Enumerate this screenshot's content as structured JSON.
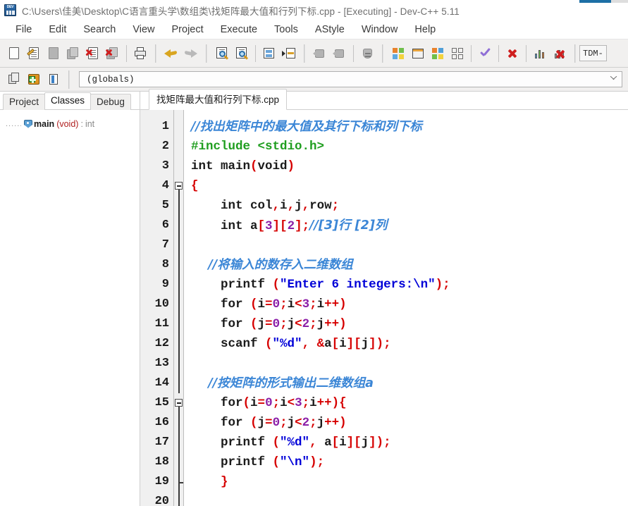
{
  "titlebar": {
    "title": "C:\\Users\\佳美\\Desktop\\C语言重头学\\数组类\\找矩阵最大值和行列下标.cpp - [Executing] - Dev-C++ 5.11",
    "icon": "devcpp-app-icon"
  },
  "menubar": {
    "items": [
      {
        "label": "File"
      },
      {
        "label": "Edit"
      },
      {
        "label": "Search"
      },
      {
        "label": "View"
      },
      {
        "label": "Project"
      },
      {
        "label": "Execute"
      },
      {
        "label": "Tools"
      },
      {
        "label": "AStyle"
      },
      {
        "label": "Window"
      },
      {
        "label": "Help"
      }
    ]
  },
  "toolbar": {
    "compiler_select": "TDM-",
    "buttons": [
      {
        "name": "new-file-icon"
      },
      {
        "name": "open-file-icon"
      },
      {
        "name": "save-file-icon"
      },
      {
        "name": "save-all-icon"
      },
      {
        "name": "close-file-icon"
      },
      {
        "name": "close-all-icon"
      },
      {
        "name": "print-icon"
      },
      {
        "name": "undo-icon"
      },
      {
        "name": "redo-icon"
      },
      {
        "name": "find-icon"
      },
      {
        "name": "replace-icon"
      },
      {
        "name": "goto-line-icon"
      },
      {
        "name": "goto-function-icon"
      },
      {
        "name": "back-icon"
      },
      {
        "name": "forward-icon"
      },
      {
        "name": "toggle-breakpoint-icon"
      },
      {
        "name": "compile-icon"
      },
      {
        "name": "run-icon"
      },
      {
        "name": "compile-and-run-icon"
      },
      {
        "name": "rebuild-all-icon"
      },
      {
        "name": "syntax-check-icon"
      },
      {
        "name": "stop-execution-icon"
      },
      {
        "name": "profile-icon"
      },
      {
        "name": "delete-profile-icon"
      }
    ]
  },
  "toolbar2": {
    "buttons": [
      {
        "name": "new-project-icon"
      },
      {
        "name": "add-to-project-icon"
      },
      {
        "name": "project-options-icon"
      }
    ],
    "scope_combo": "(globals)"
  },
  "left_panel": {
    "tabs": [
      {
        "label": "Project",
        "active": false
      },
      {
        "label": "Classes",
        "active": true
      },
      {
        "label": "Debug",
        "active": false
      }
    ],
    "tree": {
      "dots": "......",
      "name": "main",
      "params": "(void)",
      "separator": " : ",
      "return_type": "int"
    }
  },
  "editor": {
    "tab_label": "找矩阵最大值和行列下标.cpp",
    "lines": [
      {
        "n": "1",
        "fold": "none",
        "tokens": [
          {
            "t": "//找出矩阵中的最大值及其行下标和列下标",
            "c": "cmt-cjk"
          }
        ]
      },
      {
        "n": "2",
        "fold": "none",
        "tokens": [
          {
            "t": "#include <stdio.h>",
            "c": "pre"
          }
        ]
      },
      {
        "n": "3",
        "fold": "none",
        "tokens": [
          {
            "t": "int main",
            "c": "kw"
          },
          {
            "t": "(",
            "c": "punc"
          },
          {
            "t": "void",
            "c": "kw"
          },
          {
            "t": ")",
            "c": "punc"
          }
        ]
      },
      {
        "n": "4",
        "fold": "open",
        "tokens": [
          {
            "t": "{",
            "c": "punc"
          }
        ]
      },
      {
        "n": "5",
        "fold": "bar",
        "tokens": [
          {
            "t": "    int col",
            "c": "kw"
          },
          {
            "t": ",",
            "c": "punc"
          },
          {
            "t": "i",
            "c": "kw"
          },
          {
            "t": ",",
            "c": "punc"
          },
          {
            "t": "j",
            "c": "kw"
          },
          {
            "t": ",",
            "c": "punc"
          },
          {
            "t": "row",
            "c": "kw"
          },
          {
            "t": ";",
            "c": "punc"
          }
        ]
      },
      {
        "n": "6",
        "fold": "bar",
        "tokens": [
          {
            "t": "    int a",
            "c": "kw"
          },
          {
            "t": "[",
            "c": "punc"
          },
          {
            "t": "3",
            "c": "num"
          },
          {
            "t": "][",
            "c": "punc"
          },
          {
            "t": "2",
            "c": "num"
          },
          {
            "t": "];",
            "c": "punc"
          },
          {
            "t": "//[3]行 [2]列",
            "c": "cmt-cjk"
          }
        ]
      },
      {
        "n": "7",
        "fold": "bar",
        "tokens": []
      },
      {
        "n": "8",
        "fold": "bar",
        "tokens": [
          {
            "t": "    //将输入的数存入二维数组",
            "c": "cmt-cjk"
          }
        ]
      },
      {
        "n": "9",
        "fold": "bar",
        "tokens": [
          {
            "t": "    printf ",
            "c": "kw"
          },
          {
            "t": "(",
            "c": "punc"
          },
          {
            "t": "\"Enter 6 integers:\\n\"",
            "c": "str"
          },
          {
            "t": ");",
            "c": "punc"
          }
        ]
      },
      {
        "n": "10",
        "fold": "bar",
        "tokens": [
          {
            "t": "    for ",
            "c": "kw"
          },
          {
            "t": "(",
            "c": "punc"
          },
          {
            "t": "i",
            "c": "kw"
          },
          {
            "t": "=",
            "c": "punc"
          },
          {
            "t": "0",
            "c": "num"
          },
          {
            "t": ";",
            "c": "punc"
          },
          {
            "t": "i",
            "c": "kw"
          },
          {
            "t": "<",
            "c": "punc"
          },
          {
            "t": "3",
            "c": "num"
          },
          {
            "t": ";",
            "c": "punc"
          },
          {
            "t": "i",
            "c": "kw"
          },
          {
            "t": "++)",
            "c": "punc"
          }
        ]
      },
      {
        "n": "11",
        "fold": "bar",
        "tokens": [
          {
            "t": "    for ",
            "c": "kw"
          },
          {
            "t": "(",
            "c": "punc"
          },
          {
            "t": "j",
            "c": "kw"
          },
          {
            "t": "=",
            "c": "punc"
          },
          {
            "t": "0",
            "c": "num"
          },
          {
            "t": ";",
            "c": "punc"
          },
          {
            "t": "j",
            "c": "kw"
          },
          {
            "t": "<",
            "c": "punc"
          },
          {
            "t": "2",
            "c": "num"
          },
          {
            "t": ";",
            "c": "punc"
          },
          {
            "t": "j",
            "c": "kw"
          },
          {
            "t": "++)",
            "c": "punc"
          }
        ]
      },
      {
        "n": "12",
        "fold": "bar",
        "tokens": [
          {
            "t": "    scanf ",
            "c": "kw"
          },
          {
            "t": "(",
            "c": "punc"
          },
          {
            "t": "\"%d\"",
            "c": "str"
          },
          {
            "t": ", &",
            "c": "punc"
          },
          {
            "t": "a",
            "c": "kw"
          },
          {
            "t": "[",
            "c": "punc"
          },
          {
            "t": "i",
            "c": "kw"
          },
          {
            "t": "][",
            "c": "punc"
          },
          {
            "t": "j",
            "c": "kw"
          },
          {
            "t": "]);",
            "c": "punc"
          }
        ]
      },
      {
        "n": "13",
        "fold": "bar",
        "tokens": []
      },
      {
        "n": "14",
        "fold": "bar",
        "tokens": [
          {
            "t": "    //按矩阵的形式输出二维数组a",
            "c": "cmt-cjk"
          }
        ]
      },
      {
        "n": "15",
        "fold": "open",
        "tokens": [
          {
            "t": "    for",
            "c": "kw"
          },
          {
            "t": "(",
            "c": "punc"
          },
          {
            "t": "i",
            "c": "kw"
          },
          {
            "t": "=",
            "c": "punc"
          },
          {
            "t": "0",
            "c": "num"
          },
          {
            "t": ";",
            "c": "punc"
          },
          {
            "t": "i",
            "c": "kw"
          },
          {
            "t": "<",
            "c": "punc"
          },
          {
            "t": "3",
            "c": "num"
          },
          {
            "t": ";",
            "c": "punc"
          },
          {
            "t": "i",
            "c": "kw"
          },
          {
            "t": "++){",
            "c": "punc"
          }
        ]
      },
      {
        "n": "16",
        "fold": "bar",
        "tokens": [
          {
            "t": "    for ",
            "c": "kw"
          },
          {
            "t": "(",
            "c": "punc"
          },
          {
            "t": "j",
            "c": "kw"
          },
          {
            "t": "=",
            "c": "punc"
          },
          {
            "t": "0",
            "c": "num"
          },
          {
            "t": ";",
            "c": "punc"
          },
          {
            "t": "j",
            "c": "kw"
          },
          {
            "t": "<",
            "c": "punc"
          },
          {
            "t": "2",
            "c": "num"
          },
          {
            "t": ";",
            "c": "punc"
          },
          {
            "t": "j",
            "c": "kw"
          },
          {
            "t": "++)",
            "c": "punc"
          }
        ]
      },
      {
        "n": "17",
        "fold": "bar",
        "tokens": [
          {
            "t": "    printf ",
            "c": "kw"
          },
          {
            "t": "(",
            "c": "punc"
          },
          {
            "t": "\"%d\"",
            "c": "str"
          },
          {
            "t": ", ",
            "c": "punc"
          },
          {
            "t": "a",
            "c": "kw"
          },
          {
            "t": "[",
            "c": "punc"
          },
          {
            "t": "i",
            "c": "kw"
          },
          {
            "t": "][",
            "c": "punc"
          },
          {
            "t": "j",
            "c": "kw"
          },
          {
            "t": "]);",
            "c": "punc"
          }
        ]
      },
      {
        "n": "18",
        "fold": "bar",
        "tokens": [
          {
            "t": "    printf ",
            "c": "kw"
          },
          {
            "t": "(",
            "c": "punc"
          },
          {
            "t": "\"\\n\"",
            "c": "str"
          },
          {
            "t": ");",
            "c": "punc"
          }
        ]
      },
      {
        "n": "19",
        "fold": "end",
        "tokens": [
          {
            "t": "    }",
            "c": "punc"
          }
        ]
      },
      {
        "n": "20",
        "fold": "bar",
        "tokens": []
      }
    ]
  },
  "colors": {
    "comment": "#3b86d6",
    "preprocessor": "#1f9e1f",
    "string": "#0000d8",
    "number": "#8b1fa8",
    "punctuation": "#d60000",
    "gutter_bg": "#f0f0f0",
    "toolbar_bg": "#f1f0ef"
  }
}
